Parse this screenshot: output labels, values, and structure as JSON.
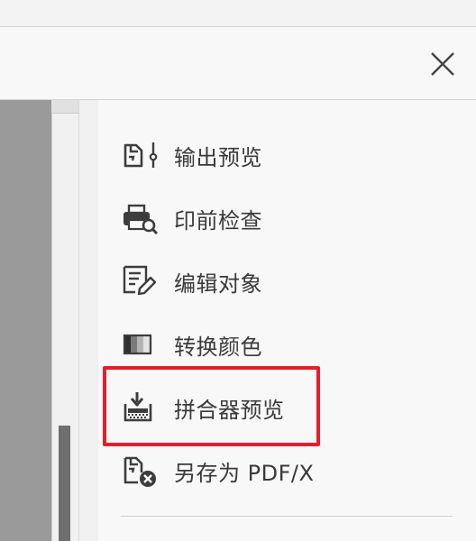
{
  "header": {
    "close_icon": "close-icon"
  },
  "tools": [
    {
      "label": "输出预览",
      "icon": "output-preview-icon"
    },
    {
      "label": "印前检查",
      "icon": "preflight-icon"
    },
    {
      "label": "编辑对象",
      "icon": "edit-object-icon"
    },
    {
      "label": "转换颜色",
      "icon": "convert-colors-icon"
    },
    {
      "label": "拼合器预览",
      "icon": "flattener-preview-icon"
    },
    {
      "label": "另存为 PDF/X",
      "icon": "save-as-pdfx-icon"
    }
  ],
  "colors": {
    "highlight": "#e3202a",
    "icon": "#3d3d3d",
    "text": "#3a3a3a"
  }
}
